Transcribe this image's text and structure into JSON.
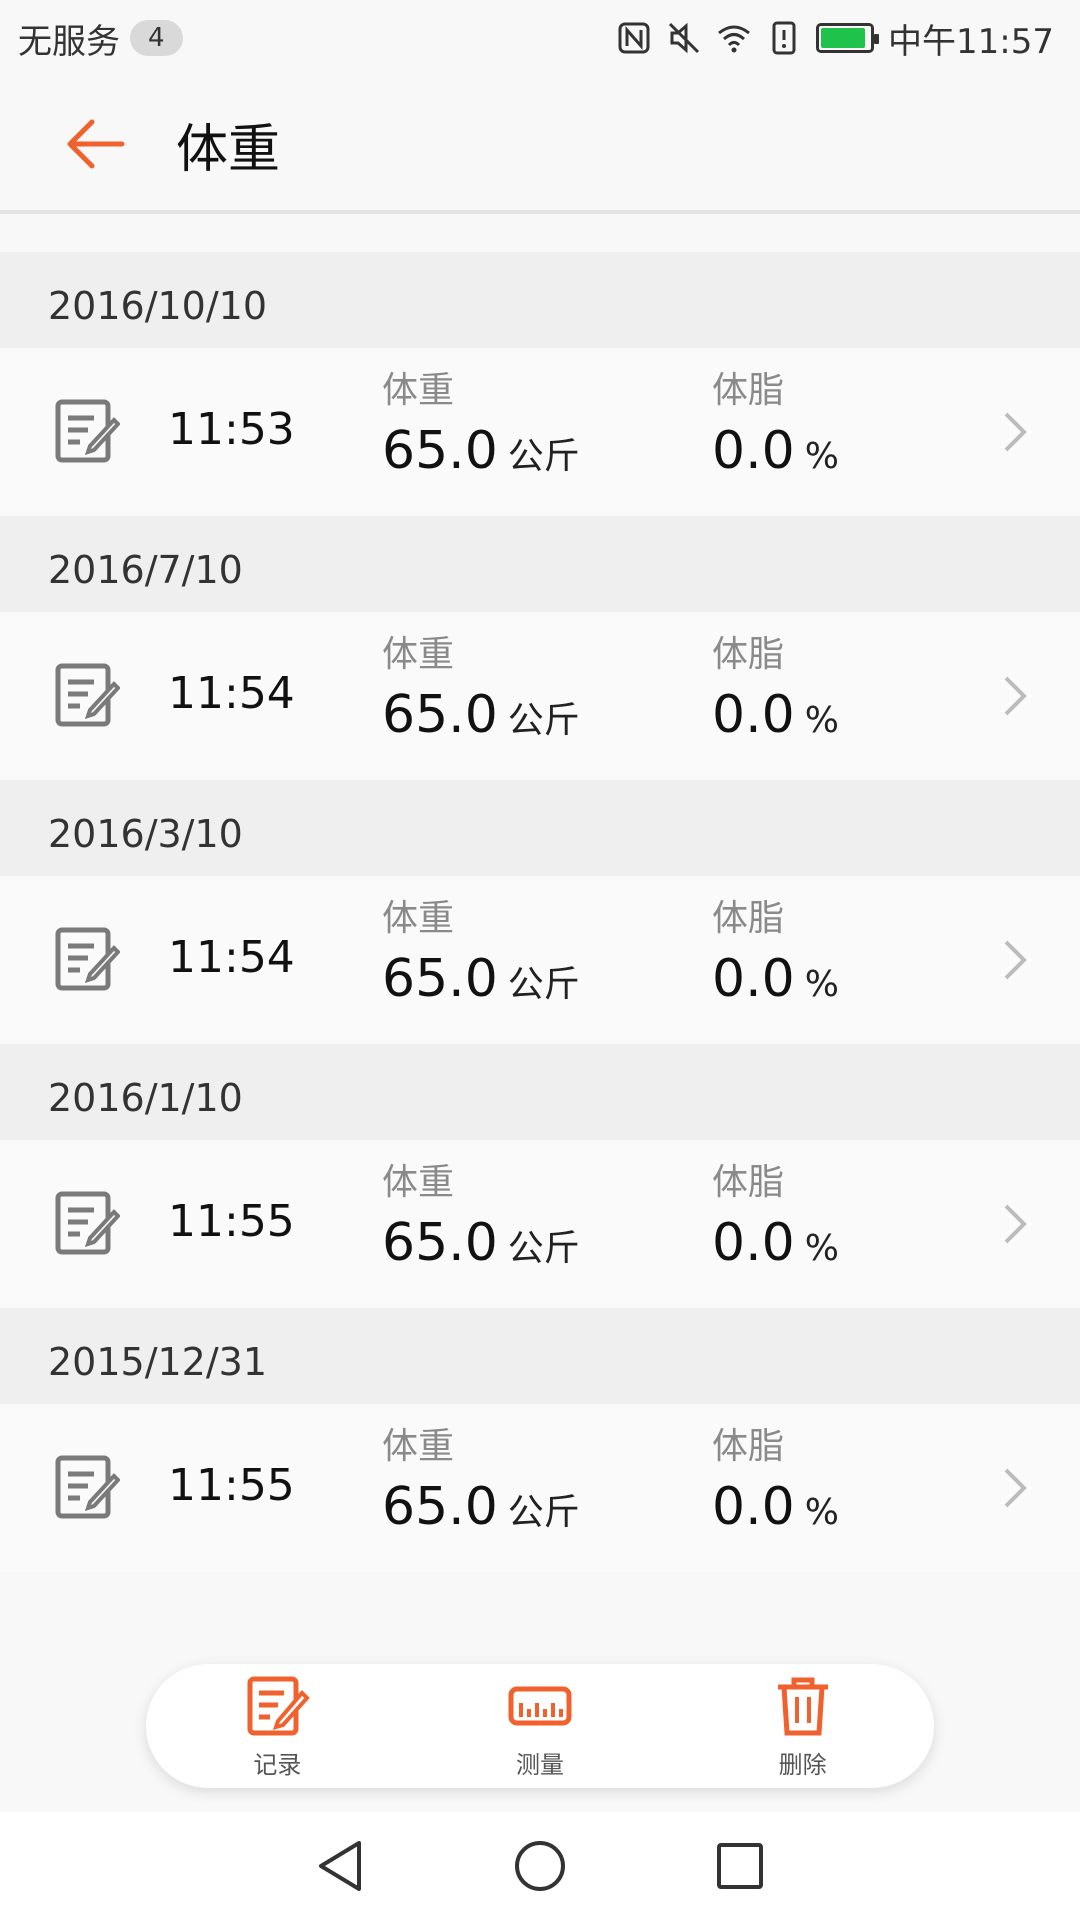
{
  "status_bar": {
    "carrier": "无服务",
    "badge": "4",
    "time": "中午11:57",
    "icons": [
      "nfc-icon",
      "mute-icon",
      "wifi-icon",
      "alert-icon",
      "battery-charging-icon"
    ],
    "battery_color": "#1fc24a"
  },
  "header": {
    "title": "体重",
    "back_icon": "arrow-left-icon",
    "accent_color": "#f0612d"
  },
  "records": [
    {
      "date": "2016/10/10",
      "time": "11:53",
      "weight_label": "体重",
      "weight_value": "65.0",
      "weight_unit": "公斤",
      "fat_label": "体脂",
      "fat_value": "0.0",
      "fat_unit": "%"
    },
    {
      "date": "2016/7/10",
      "time": "11:54",
      "weight_label": "体重",
      "weight_value": "65.0",
      "weight_unit": "公斤",
      "fat_label": "体脂",
      "fat_value": "0.0",
      "fat_unit": "%"
    },
    {
      "date": "2016/3/10",
      "time": "11:54",
      "weight_label": "体重",
      "weight_value": "65.0",
      "weight_unit": "公斤",
      "fat_label": "体脂",
      "fat_value": "0.0",
      "fat_unit": "%"
    },
    {
      "date": "2016/1/10",
      "time": "11:55",
      "weight_label": "体重",
      "weight_value": "65.0",
      "weight_unit": "公斤",
      "fat_label": "体脂",
      "fat_value": "0.0",
      "fat_unit": "%"
    },
    {
      "date": "2015/12/31",
      "time": "11:55",
      "weight_label": "体重",
      "weight_value": "65.0",
      "weight_unit": "公斤",
      "fat_label": "体脂",
      "fat_value": "0.0",
      "fat_unit": "%"
    }
  ],
  "actions": [
    {
      "label": "记录",
      "icon": "edit-note-icon"
    },
    {
      "label": "测量",
      "icon": "scale-ruler-icon"
    },
    {
      "label": "删除",
      "icon": "trash-icon"
    }
  ],
  "navigation": [
    "back-triangle-icon",
    "home-circle-icon",
    "recents-square-icon"
  ]
}
